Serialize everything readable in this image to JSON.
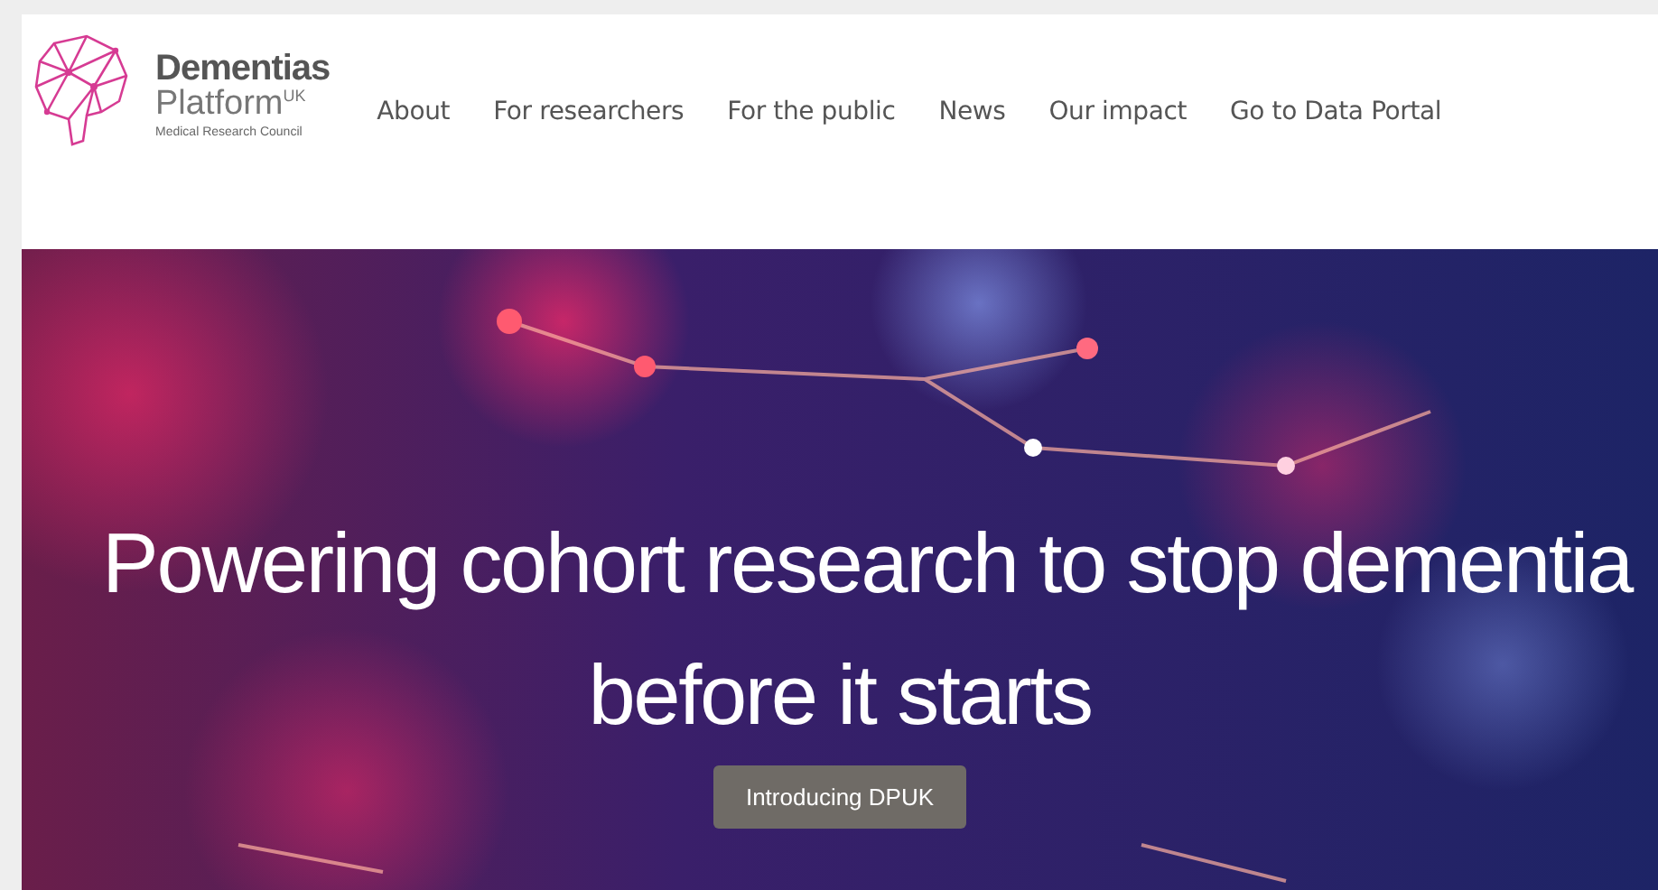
{
  "logo": {
    "title": "Dementias",
    "subtitle": "Platform$^{UK}$",
    "tagline": "Medical Research Council"
  },
  "nav": [
    {
      "label": "About"
    },
    {
      "label": "For researchers"
    },
    {
      "label": "For the public"
    },
    {
      "label": "News"
    },
    {
      "label": "Our impact"
    },
    {
      "label": "Go to Data Portal"
    }
  ],
  "hero": {
    "kind": "picture",
    "headline_lines": [
      "Powering cohort research to stop dementia",
      "before it starts"
    ],
    "button": "Introducing DPUK"
  }
}
